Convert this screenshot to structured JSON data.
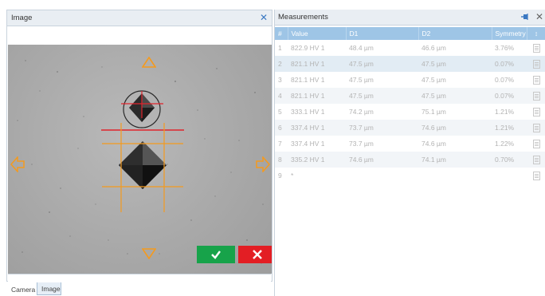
{
  "image_panel": {
    "title": "Image",
    "close_icon": "close-icon",
    "accent_color": "#3a78c2",
    "overlay_color": "#f49a1e",
    "cross_color": "#e0242c",
    "accept_color": "#17a34a",
    "reject_color": "#e31e24",
    "tabs": [
      {
        "label": "Camera",
        "active": false
      },
      {
        "label": "Image",
        "active": true
      }
    ]
  },
  "measurements_panel": {
    "title": "Measurements",
    "pin_icon": "pin-icon",
    "close_icon": "close-icon",
    "header_color": "#9ec5e6",
    "columns": [
      "#",
      "Value",
      "D1",
      "D2",
      "Symmetry",
      "↕"
    ],
    "rows": [
      {
        "num": "1",
        "value": "822.9 HV 1",
        "d1": "48.4 µm",
        "d2": "46.6 µm",
        "symmetry": "3.76%"
      },
      {
        "num": "2",
        "value": "821.1 HV 1",
        "d1": "47.5 µm",
        "d2": "47.5 µm",
        "symmetry": "0.07%"
      },
      {
        "num": "3",
        "value": "821.1 HV 1",
        "d1": "47.5 µm",
        "d2": "47.5 µm",
        "symmetry": "0.07%"
      },
      {
        "num": "4",
        "value": "821.1 HV 1",
        "d1": "47.5 µm",
        "d2": "47.5 µm",
        "symmetry": "0.07%"
      },
      {
        "num": "5",
        "value": "333.1 HV 1",
        "d1": "74.2 µm",
        "d2": "75.1 µm",
        "symmetry": "1.21%"
      },
      {
        "num": "6",
        "value": "337.4 HV 1",
        "d1": "73.7 µm",
        "d2": "74.6 µm",
        "symmetry": "1.21%"
      },
      {
        "num": "7",
        "value": "337.4 HV 1",
        "d1": "73.7 µm",
        "d2": "74.6 µm",
        "symmetry": "1.22%"
      },
      {
        "num": "8",
        "value": "335.2 HV 1",
        "d1": "74.6 µm",
        "d2": "74.1 µm",
        "symmetry": "0.70%"
      },
      {
        "num": "9",
        "value": "*",
        "d1": "",
        "d2": "",
        "symmetry": ""
      }
    ]
  }
}
